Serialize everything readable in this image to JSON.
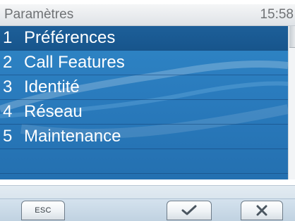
{
  "header": {
    "title": "Paramètres",
    "time": "15:58"
  },
  "menu": {
    "items": [
      {
        "number": "1",
        "label": "Préférences"
      },
      {
        "number": "2",
        "label": "Call Features"
      },
      {
        "number": "3",
        "label": "Identité"
      },
      {
        "number": "4",
        "label": "Réseau"
      },
      {
        "number": "5",
        "label": "Maintenance"
      }
    ],
    "selected_index": 0
  },
  "softkeys": {
    "esc_label": "ESC",
    "ok_icon": "checkmark-icon",
    "cancel_icon": "close-icon"
  },
  "colors": {
    "menu_background": "#2a7bbd",
    "selected_row": "#1d5f99",
    "header_text": "#6f7275",
    "item_text": "#ffffff"
  }
}
